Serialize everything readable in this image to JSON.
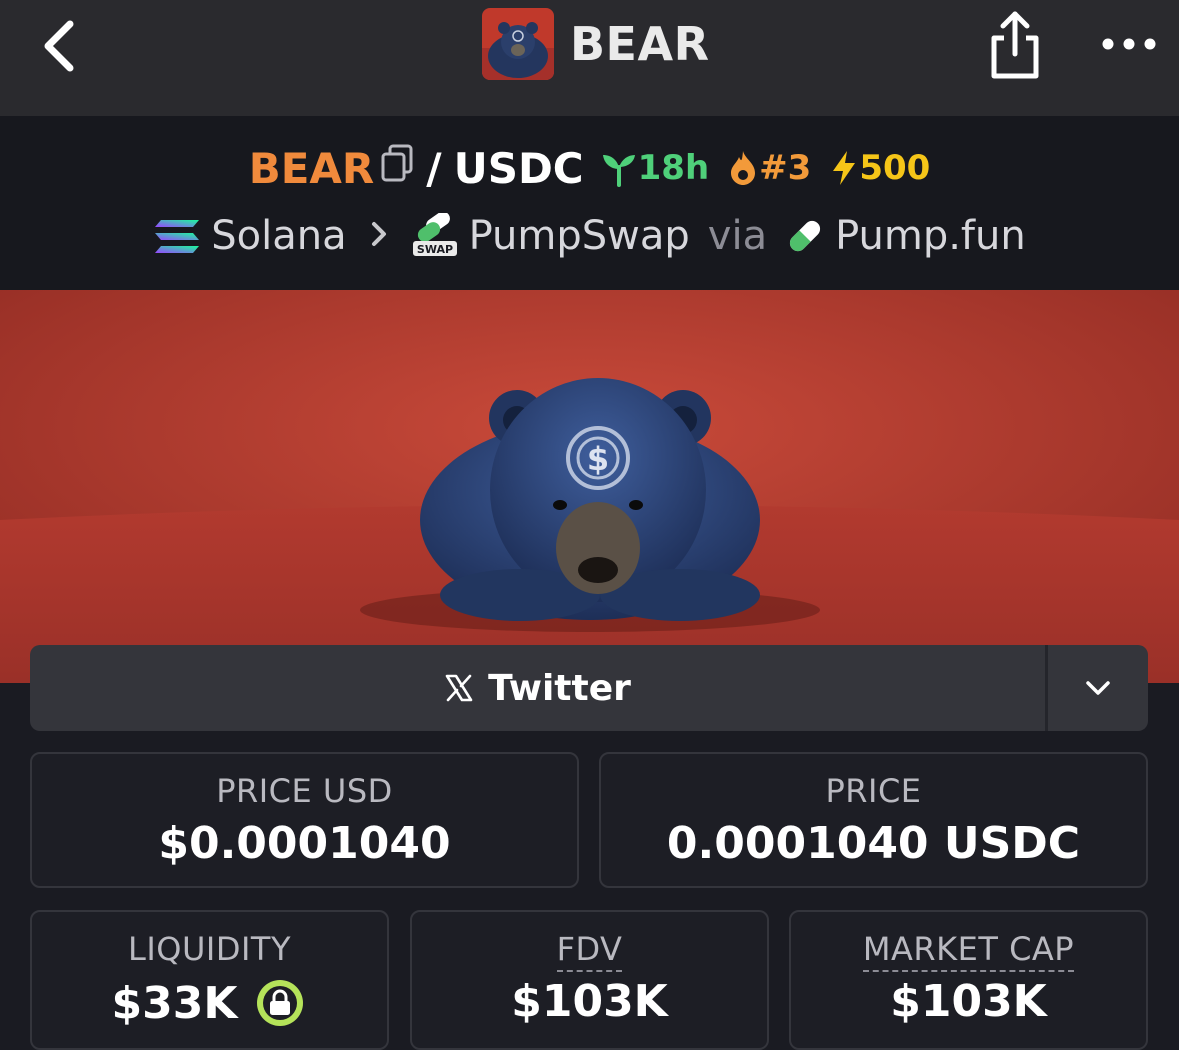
{
  "header": {
    "title": "BEAR"
  },
  "pair": {
    "base_symbol": "BEAR",
    "separator": "/",
    "quote_symbol": "USDC",
    "age": "18h",
    "rank": "#3",
    "boosts": "500"
  },
  "route": {
    "chain": "Solana",
    "dex": "PumpSwap",
    "via_label": "via",
    "launchpad": "Pump.fun"
  },
  "socials": {
    "twitter_label": "Twitter"
  },
  "stats": {
    "price_usd_label": "PRICE USD",
    "price_usd_value": "$0.0001040",
    "price_label": "PRICE",
    "price_value": "0.0001040 USDC",
    "liquidity_label": "LIQUIDITY",
    "liquidity_value": "$33K",
    "fdv_label": "FDV",
    "fdv_value": "$103K",
    "market_cap_label": "MARKET CAP",
    "market_cap_value": "$103K"
  },
  "colors": {
    "base_symbol": "#f08a3c",
    "age": "#4fd07a",
    "rank": "#f29a3a",
    "boosts": "#f5c518",
    "lock": "#b5e35a"
  },
  "icons": {
    "back": "chevron-left-icon",
    "share": "share-icon",
    "more": "more-icon",
    "copy": "copy-icon",
    "age": "seedling-icon",
    "rank": "flame-icon",
    "boosts": "bolt-icon",
    "chain": "solana-icon",
    "dex": "pumpswap-icon",
    "launchpad": "pill-icon",
    "twitter": "x-icon",
    "dropdown": "chevron-down-icon",
    "lock": "lock-icon"
  }
}
